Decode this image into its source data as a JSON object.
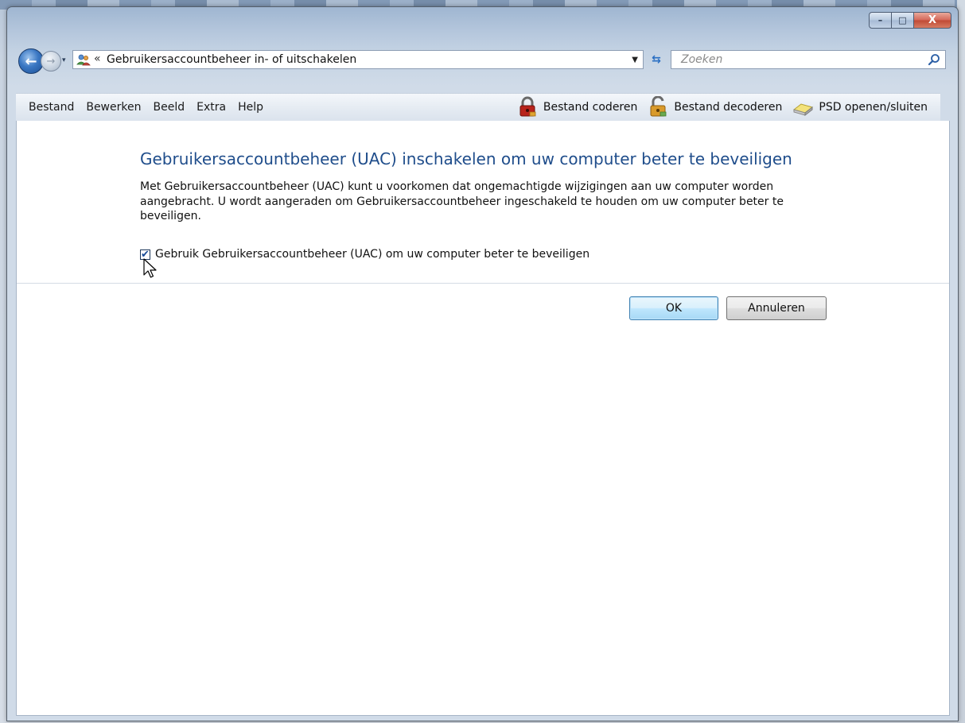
{
  "window": {
    "caption_minimize": "–",
    "caption_maximize": "□",
    "caption_close": "X"
  },
  "navigation": {
    "back_glyph": "←",
    "forward_glyph": "→",
    "dropdown_glyph": "▾"
  },
  "address": {
    "chevron": "«",
    "path": "Gebruikersaccountbeheer in- of uitschakelen",
    "dropdown_glyph": "▼",
    "refresh_glyph": "⇆"
  },
  "search": {
    "placeholder": "Zoeken"
  },
  "menu": {
    "items": [
      {
        "label": "Bestand"
      },
      {
        "label": "Bewerken"
      },
      {
        "label": "Beeld"
      },
      {
        "label": "Extra"
      },
      {
        "label": "Help"
      }
    ]
  },
  "toolbar": {
    "encode_label": "Bestand coderen",
    "decode_label": "Bestand decoderen",
    "psd_label": "PSD openen/sluiten"
  },
  "content": {
    "heading": "Gebruikersaccountbeheer (UAC) inschakelen om uw computer beter te beveiligen",
    "description": "Met Gebruikersaccountbeheer (UAC) kunt u voorkomen dat ongemachtigde wijzigingen aan uw computer worden aangebracht. U wordt aangeraden om Gebruikersaccountbeheer ingeschakeld te houden om uw computer beter te beveiligen.",
    "checkbox_label": "Gebruik Gebruikersaccountbeheer (UAC) om uw computer beter te beveiligen",
    "checkbox_checked": true,
    "check_glyph": "✔"
  },
  "buttons": {
    "ok_label": "OK",
    "cancel_label": "Annuleren"
  },
  "colors": {
    "heading": "#1f4d8b",
    "ok_border": "#3c7fb1"
  }
}
